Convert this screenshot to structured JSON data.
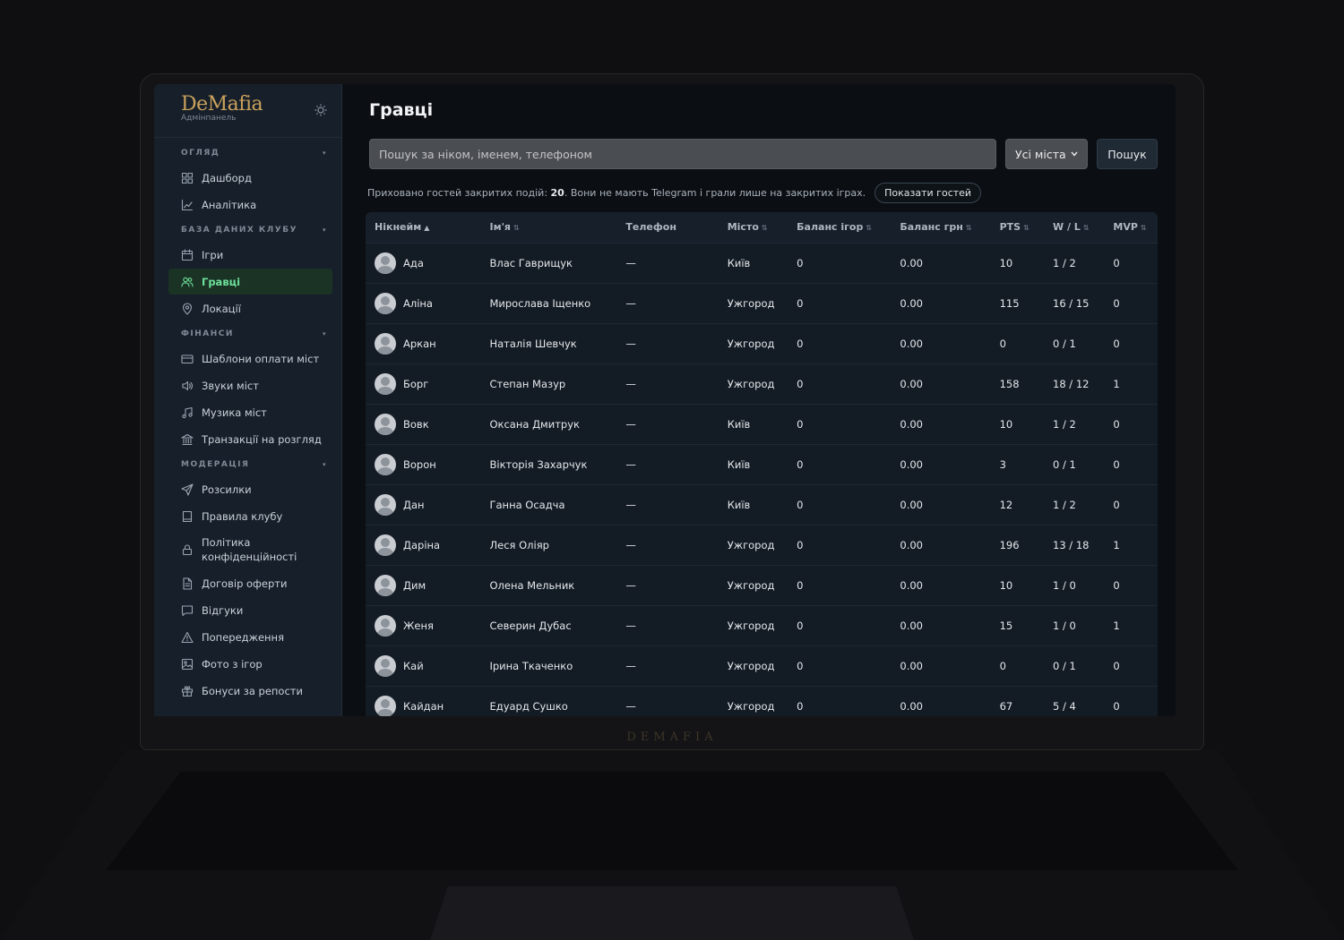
{
  "brand": {
    "logo": "DeMafia",
    "subtitle": "Адмінпанель",
    "bezel_mark": "DEMAFIA"
  },
  "sidebar": {
    "groups": [
      {
        "label": "ОГЛЯД",
        "items": [
          {
            "label": "Дашборд",
            "icon": "grid-icon"
          },
          {
            "label": "Аналітика",
            "icon": "chart-icon"
          }
        ]
      },
      {
        "label": "БАЗА ДАНИХ КЛУБУ",
        "items": [
          {
            "label": "Ігри",
            "icon": "calendar-icon"
          },
          {
            "label": "Гравці",
            "icon": "users-icon",
            "active": true
          },
          {
            "label": "Локації",
            "icon": "pin-icon"
          }
        ]
      },
      {
        "label": "ФІНАНСИ",
        "items": [
          {
            "label": "Шаблони оплати міст",
            "icon": "card-icon"
          },
          {
            "label": "Звуки міст",
            "icon": "speaker-icon"
          },
          {
            "label": "Музика міст",
            "icon": "music-icon"
          },
          {
            "label": "Транзакції на розгляд",
            "icon": "bank-icon"
          }
        ]
      },
      {
        "label": "МОДЕРАЦІЯ",
        "items": [
          {
            "label": "Розсилки",
            "icon": "send-icon"
          },
          {
            "label": "Правила клубу",
            "icon": "book-icon"
          },
          {
            "label": "Політика конфіденційності",
            "icon": "lock-icon"
          },
          {
            "label": "Договір оферти",
            "icon": "document-icon"
          },
          {
            "label": "Відгуки",
            "icon": "chat-icon"
          },
          {
            "label": "Попередження",
            "icon": "warning-icon"
          },
          {
            "label": "Фото з ігор",
            "icon": "image-icon"
          },
          {
            "label": "Бонуси за репости",
            "icon": "gift-icon"
          }
        ]
      }
    ]
  },
  "page": {
    "title": "Гравці",
    "search_placeholder": "Пошук за ніком, іменем, телефоном",
    "city_select": "Усі міста",
    "search_button": "Пошук",
    "notice_prefix": "Приховано гостей закритих подій: ",
    "notice_count": "20",
    "notice_suffix": ". Вони не мають Telegram і грали лише на закритих іграх.",
    "show_guests_button": "Показати гостей"
  },
  "table": {
    "columns": [
      "Нікнейм",
      "Ім'я",
      "Телефон",
      "Місто",
      "Баланс ігор",
      "Баланс грн",
      "PTS",
      "W / L",
      "MVP"
    ],
    "rows": [
      [
        "Ада",
        "Влас Гаврищук",
        "—",
        "Київ",
        "0",
        "0.00",
        "10",
        "1 / 2",
        "0"
      ],
      [
        "Аліна",
        "Мирослава Іщенко",
        "—",
        "Ужгород",
        "0",
        "0.00",
        "115",
        "16 / 15",
        "0"
      ],
      [
        "Аркан",
        "Наталія Шевчук",
        "—",
        "Ужгород",
        "0",
        "0.00",
        "0",
        "0 / 1",
        "0"
      ],
      [
        "Борг",
        "Степан Мазур",
        "—",
        "Ужгород",
        "0",
        "0.00",
        "158",
        "18 / 12",
        "1"
      ],
      [
        "Вовк",
        "Оксана Дмитрук",
        "—",
        "Київ",
        "0",
        "0.00",
        "10",
        "1 / 2",
        "0"
      ],
      [
        "Ворон",
        "Вікторія Захарчук",
        "—",
        "Київ",
        "0",
        "0.00",
        "3",
        "0 / 1",
        "0"
      ],
      [
        "Дан",
        "Ганна Осадча",
        "—",
        "Київ",
        "0",
        "0.00",
        "12",
        "1 / 2",
        "0"
      ],
      [
        "Даріна",
        "Леся Оліяр",
        "—",
        "Ужгород",
        "0",
        "0.00",
        "196",
        "13 / 18",
        "1"
      ],
      [
        "Дим",
        "Олена Мельник",
        "—",
        "Ужгород",
        "0",
        "0.00",
        "10",
        "1 / 0",
        "0"
      ],
      [
        "Женя",
        "Северин Дубас",
        "—",
        "Ужгород",
        "0",
        "0.00",
        "15",
        "1 / 0",
        "1"
      ],
      [
        "Кай",
        "Ірина Ткаченко",
        "—",
        "Ужгород",
        "0",
        "0.00",
        "0",
        "0 / 1",
        "0"
      ],
      [
        "Кайдан",
        "Едуард Сушко",
        "—",
        "Ужгород",
        "0",
        "0.00",
        "67",
        "5 / 4",
        "0"
      ]
    ]
  }
}
